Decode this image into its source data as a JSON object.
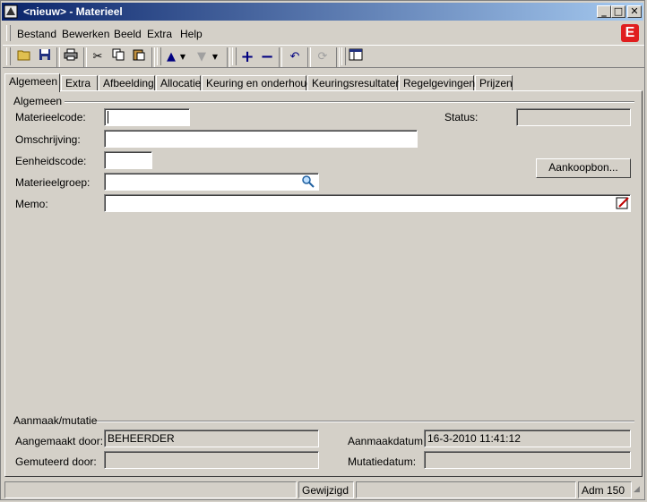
{
  "window": {
    "title": "<nieuw> - Materieel"
  },
  "menu": [
    {
      "label": "Bestand"
    },
    {
      "label": "Bewerken"
    },
    {
      "label": "Beeld"
    },
    {
      "label": "Extra"
    },
    {
      "label": "Help"
    }
  ],
  "brand_letter": "E",
  "tabs": [
    {
      "label": "Algemeen"
    },
    {
      "label": "Extra"
    },
    {
      "label": "Afbeelding"
    },
    {
      "label": "Allocatie"
    },
    {
      "label": "Keuring en onderhoud"
    },
    {
      "label": "Keuringsresultaten"
    },
    {
      "label": "Regelgevingen"
    },
    {
      "label": "Prijzen"
    }
  ],
  "general": {
    "section_title": "Algemeen",
    "materieelcode_label": "Materieelcode:",
    "materieelcode_value": "",
    "omschrijving_label": "Omschrijving:",
    "omschrijving_value": "",
    "eenheidscode_label": "Eenheidscode:",
    "eenheidscode_value": "",
    "materieelgroep_label": "Materieelgroep:",
    "materieelgroep_value": "",
    "memo_label": "Memo:",
    "memo_value": "",
    "status_label": "Status:",
    "status_value": "",
    "aankoopbon_button": "Aankoopbon..."
  },
  "audit": {
    "section_title": "Aanmaak/mutatie",
    "aangemaakt_door_label": "Aangemaakt door:",
    "aangemaakt_door_value": "BEHEERDER",
    "gemuteerd_door_label": "Gemuteerd door:",
    "gemuteerd_door_value": "",
    "aanmaakdatum_label": "Aanmaakdatum:",
    "aanmaakdatum_value": "16-3-2010 11:41:12",
    "mutatiedatum_label": "Mutatiedatum:",
    "mutatiedatum_value": ""
  },
  "statusbar": {
    "pane1": "",
    "pane2": "Gewijzigd",
    "pane3": "",
    "pane4": "Adm 150"
  },
  "colors": {
    "titlebar_start": "#0a246a",
    "titlebar_end": "#a6caf0",
    "window_bg": "#d4d0c8",
    "brand_red": "#e01e1e"
  }
}
